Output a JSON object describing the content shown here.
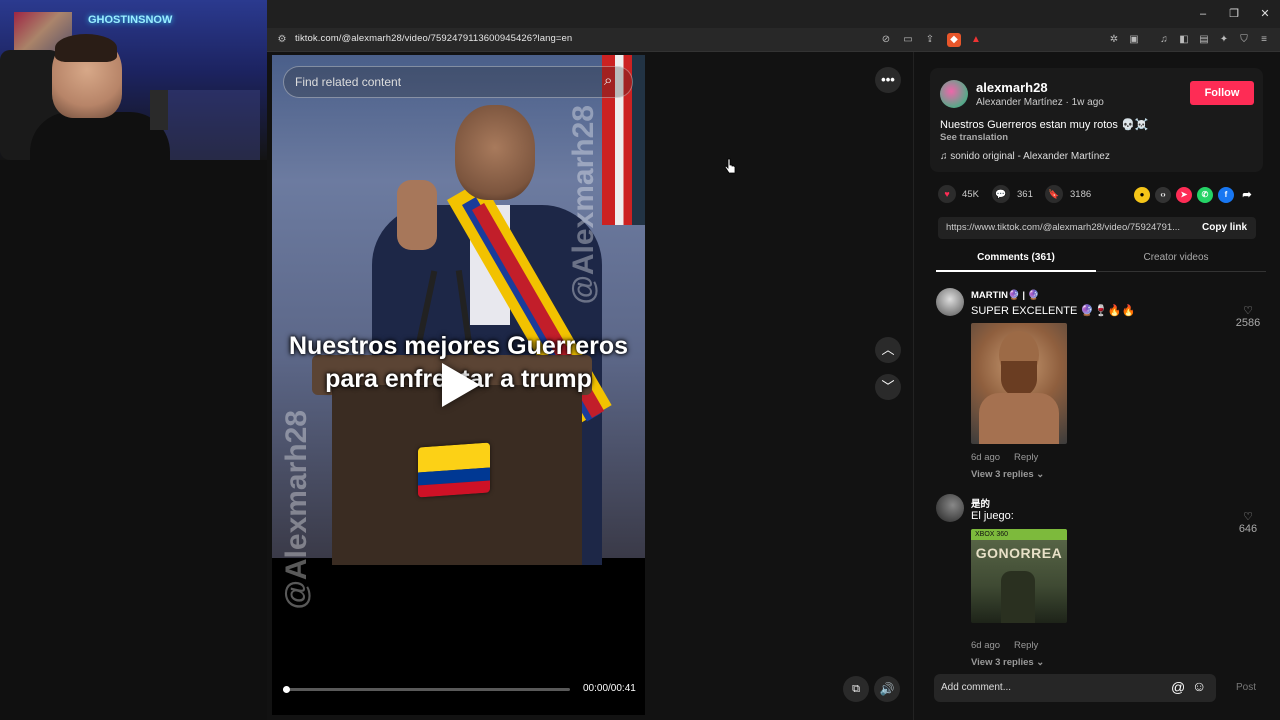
{
  "webcam": {
    "neon_sign": "GHOSTINSNOW"
  },
  "browser": {
    "url": "tiktok.com/@alexmarh28/video/7592479113600945426?lang=en",
    "window_controls": [
      "–",
      "❐",
      "✕"
    ]
  },
  "video": {
    "search_placeholder": "Find related content",
    "caption_line1": "Nuestros mejores Guerreros",
    "caption_line2": "para enfrentar a trump",
    "watermark": "@Alexmarh28",
    "timecode": "00:00/00:41",
    "progress": 0.01
  },
  "post": {
    "username": "alexmarh28",
    "display_name": "Alexander Martínez",
    "age": "1w ago",
    "follow_label": "Follow",
    "description": "Nuestros Guerreros estan muy rotos 💀☠️",
    "see_translation": "See translation",
    "sound": "sonido original - Alexander Martínez",
    "likes": "45K",
    "comments": "361",
    "saves": "3186",
    "link": "https://www.tiktok.com/@alexmarh28/video/75924791...",
    "copy_link": "Copy link"
  },
  "tabs": {
    "comments": "Comments (361)",
    "creator": "Creator videos"
  },
  "comments": [
    {
      "name": "MARTIN🔮 | 🔮",
      "text": "SUPER EXCELENTE 🔮🍷🔥🔥",
      "time": "6d ago",
      "reply": "Reply",
      "replies": "View 3 replies ⌄",
      "likes": "2586"
    },
    {
      "name": "是的",
      "text": "El juego:",
      "time": "6d ago",
      "reply": "Reply",
      "replies": "View 3 replies ⌄",
      "likes": "646",
      "image_text": "GONORREA",
      "image_sub": "XBOX 360"
    }
  ],
  "comment_bar": {
    "placeholder": "Add comment...",
    "post": "Post"
  },
  "colors": {
    "accent": "#fe2c55",
    "panel": "#121212"
  }
}
